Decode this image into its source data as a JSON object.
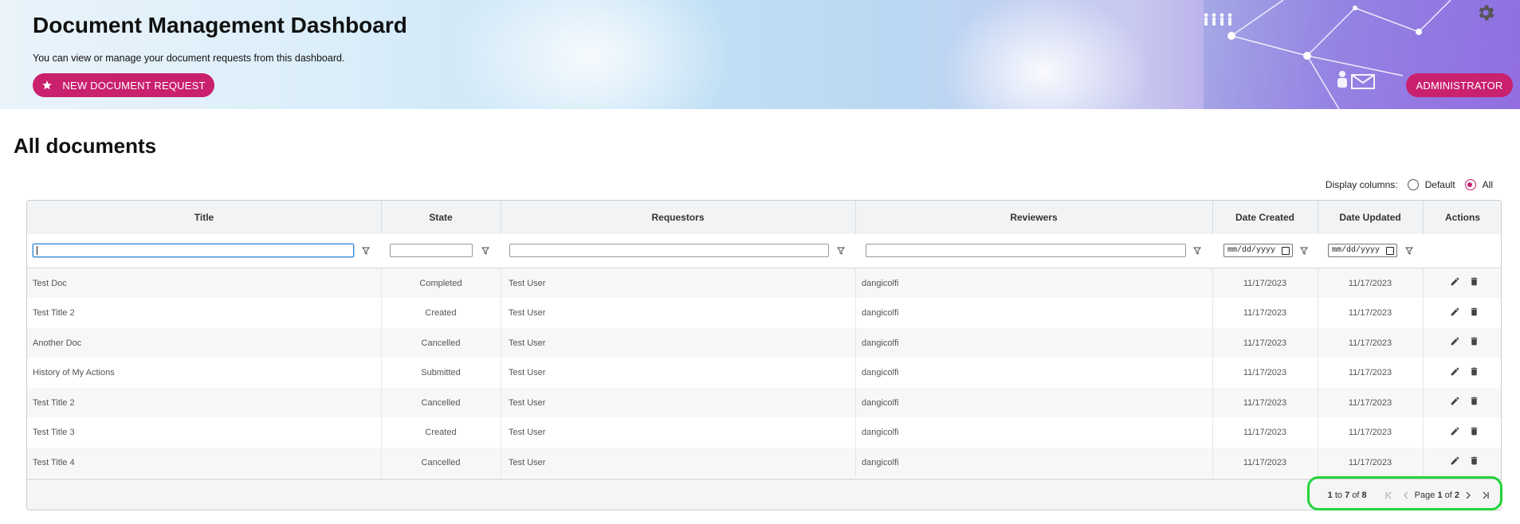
{
  "header": {
    "title": "Document Management Dashboard",
    "subtitle": "You can view or manage your document requests from this dashboard.",
    "new_request_label": "NEW DOCUMENT REQUEST",
    "admin_label": "ADMINISTRATOR"
  },
  "section": {
    "heading": "All documents",
    "display_columns_label": "Display columns:",
    "options": [
      {
        "label": "Default",
        "selected": false
      },
      {
        "label": "All",
        "selected": true
      }
    ]
  },
  "table": {
    "columns": [
      "Title",
      "State",
      "Requestors",
      "Reviewers",
      "Date Created",
      "Date Updated",
      "Actions"
    ],
    "filters": {
      "title": "",
      "state": "",
      "requestors": "",
      "reviewers": "",
      "date_created_placeholder": "mm/dd/yyyy",
      "date_updated_placeholder": "mm/dd/yyyy"
    },
    "rows": [
      {
        "title": "Test Doc",
        "state": "Completed",
        "requestors": "Test User",
        "reviewers": "dangicolfi",
        "created": "11/17/2023",
        "updated": "11/17/2023"
      },
      {
        "title": "Test Title 2",
        "state": "Created",
        "requestors": "Test User",
        "reviewers": "dangicolfi",
        "created": "11/17/2023",
        "updated": "11/17/2023"
      },
      {
        "title": "Another Doc",
        "state": "Cancelled",
        "requestors": "Test User",
        "reviewers": "dangicolfi",
        "created": "11/17/2023",
        "updated": "11/17/2023"
      },
      {
        "title": "History of My Actions",
        "state": "Submitted",
        "requestors": "Test User",
        "reviewers": "dangicolfi",
        "created": "11/17/2023",
        "updated": "11/17/2023"
      },
      {
        "title": "Test Title 2",
        "state": "Cancelled",
        "requestors": "Test User",
        "reviewers": "dangicolfi",
        "created": "11/17/2023",
        "updated": "11/17/2023"
      },
      {
        "title": "Test Title 3",
        "state": "Created",
        "requestors": "Test User",
        "reviewers": "dangicolfi",
        "created": "11/17/2023",
        "updated": "11/17/2023"
      },
      {
        "title": "Test Title 4",
        "state": "Cancelled",
        "requestors": "Test User",
        "reviewers": "dangicolfi",
        "created": "11/17/2023",
        "updated": "11/17/2023"
      }
    ]
  },
  "pagination": {
    "from": "1",
    "to_word": "to",
    "to": "7",
    "of_word": "of",
    "total": "8",
    "page_word": "Page",
    "page": "1",
    "page_of_word": "of",
    "pages": "2"
  },
  "icons": {
    "settings": "gear-icon",
    "new_request": "star-icon",
    "filter": "filter-icon",
    "edit": "pencil-icon",
    "delete": "trash-icon",
    "first": "first-page-icon",
    "prev": "prev-page-icon",
    "next": "next-page-icon",
    "last": "last-page-icon"
  },
  "colors": {
    "accent": "#c9216e",
    "focus": "#3d8fd6",
    "highlight": "#22d438"
  }
}
